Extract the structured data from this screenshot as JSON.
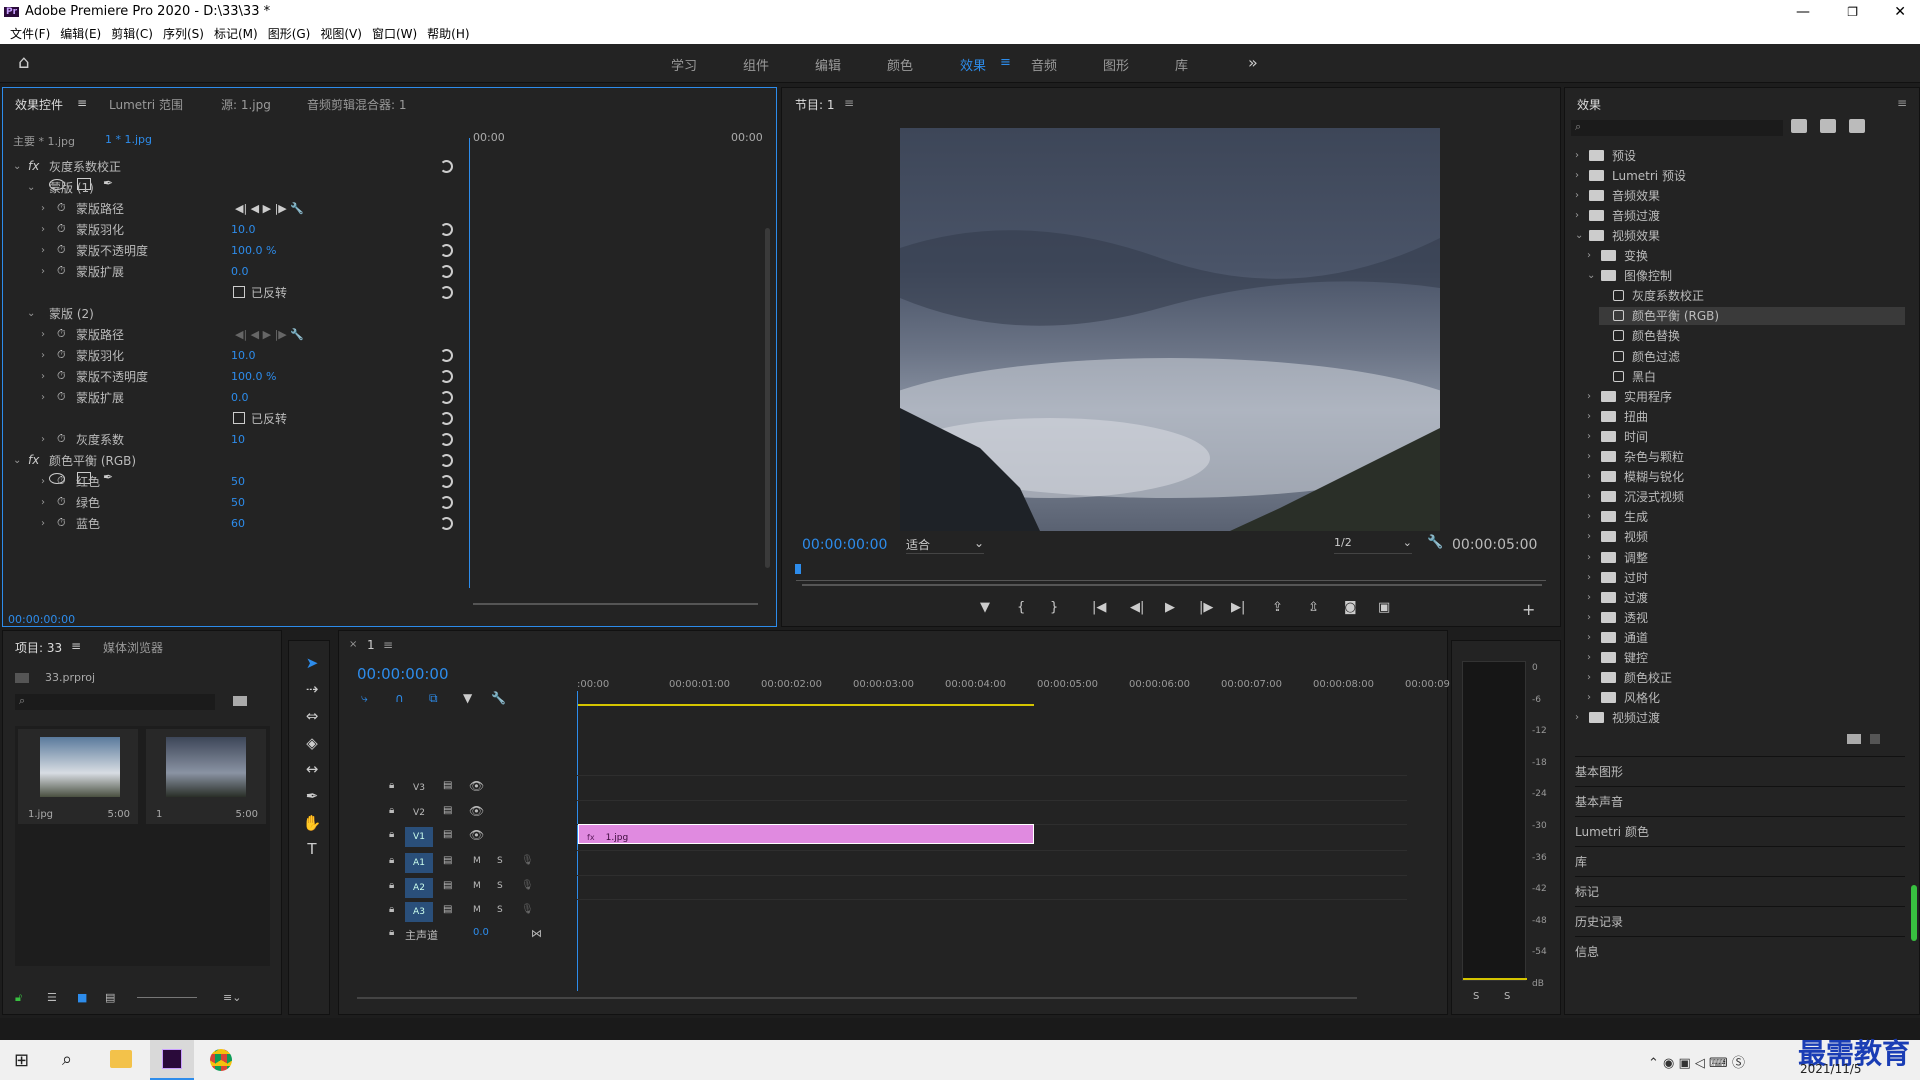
{
  "app": {
    "title": "Adobe Premiere Pro 2020 - D:\\33\\33 *",
    "logo": "Pr"
  },
  "menu": [
    "文件(F)",
    "编辑(E)",
    "剪辑(C)",
    "序列(S)",
    "标记(M)",
    "图形(G)",
    "视图(V)",
    "窗口(W)",
    "帮助(H)"
  ],
  "workspaces": [
    "学习",
    "组件",
    "编辑",
    "颜色",
    "效果",
    "音频",
    "图形",
    "库"
  ],
  "active_workspace": "效果",
  "effect_controls": {
    "tabs": [
      "效果控件",
      "Lumetri 范围",
      "源: 1.jpg",
      "音频剪辑混合器: 1"
    ],
    "master": "主要 * 1.jpg",
    "clip": "1 * 1.jpg",
    "tc_start": "00:00",
    "tc_end": "00:00",
    "footer_tc": "00:00:00:00",
    "rows": [
      {
        "label": "灰度系数校正",
        "kind": "fx"
      },
      {
        "label": "蒙版 (1)",
        "kind": "group"
      },
      {
        "label": "蒙版路径",
        "kind": "path"
      },
      {
        "label": "蒙版羽化",
        "value": "10.0"
      },
      {
        "label": "蒙版不透明度",
        "value": "100.0 %"
      },
      {
        "label": "蒙版扩展",
        "value": "0.0"
      },
      {
        "label": "已反转",
        "kind": "check"
      },
      {
        "label": "蒙版 (2)",
        "kind": "group"
      },
      {
        "label": "蒙版路径",
        "kind": "path"
      },
      {
        "label": "蒙版羽化",
        "value": "10.0"
      },
      {
        "label": "蒙版不透明度",
        "value": "100.0 %"
      },
      {
        "label": "蒙版扩展",
        "value": "0.0"
      },
      {
        "label": "已反转",
        "kind": "check"
      },
      {
        "label": "灰度系数",
        "value": "10"
      },
      {
        "label": "颜色平衡 (RGB)",
        "kind": "fx"
      },
      {
        "label": "红色",
        "value": "50"
      },
      {
        "label": "绿色",
        "value": "50"
      },
      {
        "label": "蓝色",
        "value": "60"
      }
    ]
  },
  "program": {
    "tab": "节目: 1",
    "tc_current": "00:00:00:00",
    "tc_duration": "00:00:05:00",
    "fit": "适合",
    "quality": "1/2"
  },
  "effects": {
    "title": "效果",
    "tree": [
      {
        "label": "预设",
        "level": 0,
        "type": "folder",
        "open": false
      },
      {
        "label": "Lumetri 预设",
        "level": 0,
        "type": "folder",
        "open": false
      },
      {
        "label": "音频效果",
        "level": 0,
        "type": "folder",
        "open": false
      },
      {
        "label": "音频过渡",
        "level": 0,
        "type": "folder",
        "open": false
      },
      {
        "label": "视频效果",
        "level": 0,
        "type": "folder",
        "open": true
      },
      {
        "label": "变换",
        "level": 1,
        "type": "folder",
        "open": false
      },
      {
        "label": "图像控制",
        "level": 1,
        "type": "folder",
        "open": true
      },
      {
        "label": "灰度系数校正",
        "level": 2,
        "type": "fx"
      },
      {
        "label": "颜色平衡 (RGB)",
        "level": 2,
        "type": "fx",
        "selected": true
      },
      {
        "label": "颜色替换",
        "level": 2,
        "type": "fx"
      },
      {
        "label": "颜色过滤",
        "level": 2,
        "type": "fx"
      },
      {
        "label": "黑白",
        "level": 2,
        "type": "fx"
      },
      {
        "label": "实用程序",
        "level": 1,
        "type": "folder",
        "open": false
      },
      {
        "label": "扭曲",
        "level": 1,
        "type": "folder",
        "open": false
      },
      {
        "label": "时间",
        "level": 1,
        "type": "folder",
        "open": false
      },
      {
        "label": "杂色与颗粒",
        "level": 1,
        "type": "folder",
        "open": false
      },
      {
        "label": "模糊与锐化",
        "level": 1,
        "type": "folder",
        "open": false
      },
      {
        "label": "沉浸式视频",
        "level": 1,
        "type": "folder",
        "open": false
      },
      {
        "label": "生成",
        "level": 1,
        "type": "folder",
        "open": false
      },
      {
        "label": "视频",
        "level": 1,
        "type": "folder",
        "open": false
      },
      {
        "label": "调整",
        "level": 1,
        "type": "folder",
        "open": false
      },
      {
        "label": "过时",
        "level": 1,
        "type": "folder",
        "open": false
      },
      {
        "label": "过渡",
        "level": 1,
        "type": "folder",
        "open": false
      },
      {
        "label": "透视",
        "level": 1,
        "type": "folder",
        "open": false
      },
      {
        "label": "通道",
        "level": 1,
        "type": "folder",
        "open": false
      },
      {
        "label": "键控",
        "level": 1,
        "type": "folder",
        "open": false
      },
      {
        "label": "颜色校正",
        "level": 1,
        "type": "folder",
        "open": false
      },
      {
        "label": "风格化",
        "level": 1,
        "type": "folder",
        "open": false
      },
      {
        "label": "视频过渡",
        "level": 0,
        "type": "folder",
        "open": false
      }
    ],
    "collapsed_panels": [
      "基本图形",
      "基本声音",
      "Lumetri 颜色",
      "库",
      "标记",
      "历史记录",
      "信息"
    ]
  },
  "project": {
    "tabs": [
      "项目: 33",
      "媒体浏览器"
    ],
    "file": "33.prproj",
    "items": [
      {
        "name": "1.jpg",
        "dur": "5:00"
      },
      {
        "name": "1",
        "dur": "5:00"
      }
    ]
  },
  "timeline": {
    "tab": "1",
    "tc": "00:00:00:00",
    "ruler": [
      ":00:00",
      "00:00:01:00",
      "00:00:02:00",
      "00:00:03:00",
      "00:00:04:00",
      "00:00:05:00",
      "00:00:06:00",
      "00:00:07:00",
      "00:00:08:00",
      "00:00:09:"
    ],
    "video_tracks": [
      "V3",
      "V2",
      "V1"
    ],
    "audio_tracks": [
      "A1",
      "A2",
      "A3"
    ],
    "master": "主声道",
    "master_val": "0.0",
    "clip": "1.jpg"
  },
  "meter": {
    "scale": [
      "0",
      "-6",
      "-12",
      "-18",
      "-24",
      "-30",
      "-36",
      "-42",
      "-48",
      "-54",
      "dB"
    ],
    "solo": [
      "S",
      "S"
    ]
  },
  "taskbar": {
    "date": "2021/11/5",
    "watermark": "最需教育"
  }
}
